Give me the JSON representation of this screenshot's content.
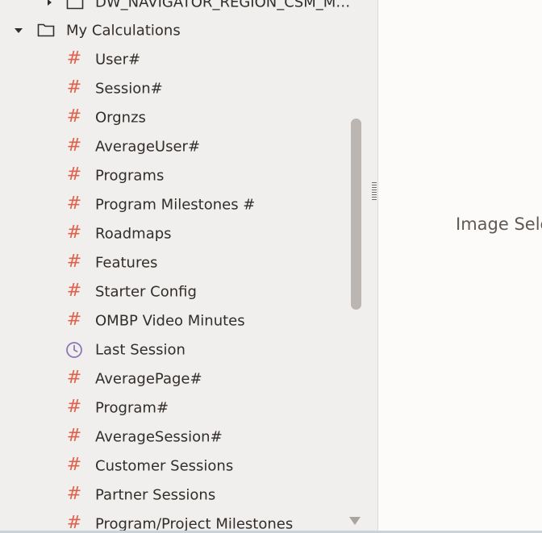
{
  "tree": {
    "partial_item": {
      "label": "DW_NAVIGATOR_REGION_CSM_M…"
    },
    "folder": {
      "label": "My Calculations",
      "expanded": true,
      "icon": "folder-icon"
    },
    "items": [
      {
        "label": "User#",
        "icon": "hash-icon"
      },
      {
        "label": "Session#",
        "icon": "hash-icon"
      },
      {
        "label": "Orgnzs",
        "icon": "hash-icon"
      },
      {
        "label": "AverageUser#",
        "icon": "hash-icon"
      },
      {
        "label": "Programs",
        "icon": "hash-icon"
      },
      {
        "label": "Program Milestones #",
        "icon": "hash-icon"
      },
      {
        "label": "Roadmaps",
        "icon": "hash-icon"
      },
      {
        "label": "Features",
        "icon": "hash-icon"
      },
      {
        "label": "Starter Config",
        "icon": "hash-icon"
      },
      {
        "label": "OMBP Video Minutes",
        "icon": "hash-icon"
      },
      {
        "label": "Last Session",
        "icon": "clock-icon"
      },
      {
        "label": "AveragePage#",
        "icon": "hash-icon"
      },
      {
        "label": "Program#",
        "icon": "hash-icon"
      },
      {
        "label": "AverageSession#",
        "icon": "hash-icon"
      },
      {
        "label": "Customer Sessions",
        "icon": "hash-icon"
      },
      {
        "label": "Partner Sessions",
        "icon": "hash-icon"
      },
      {
        "label": "Program/Project Milestones",
        "icon": "hash-icon"
      }
    ]
  },
  "canvas": {
    "placeholder_text": "Image Sele"
  },
  "colors": {
    "hash_icon": "#e0604a",
    "clock_icon": "#8c78b4",
    "panel_bg": "#f1efed"
  }
}
